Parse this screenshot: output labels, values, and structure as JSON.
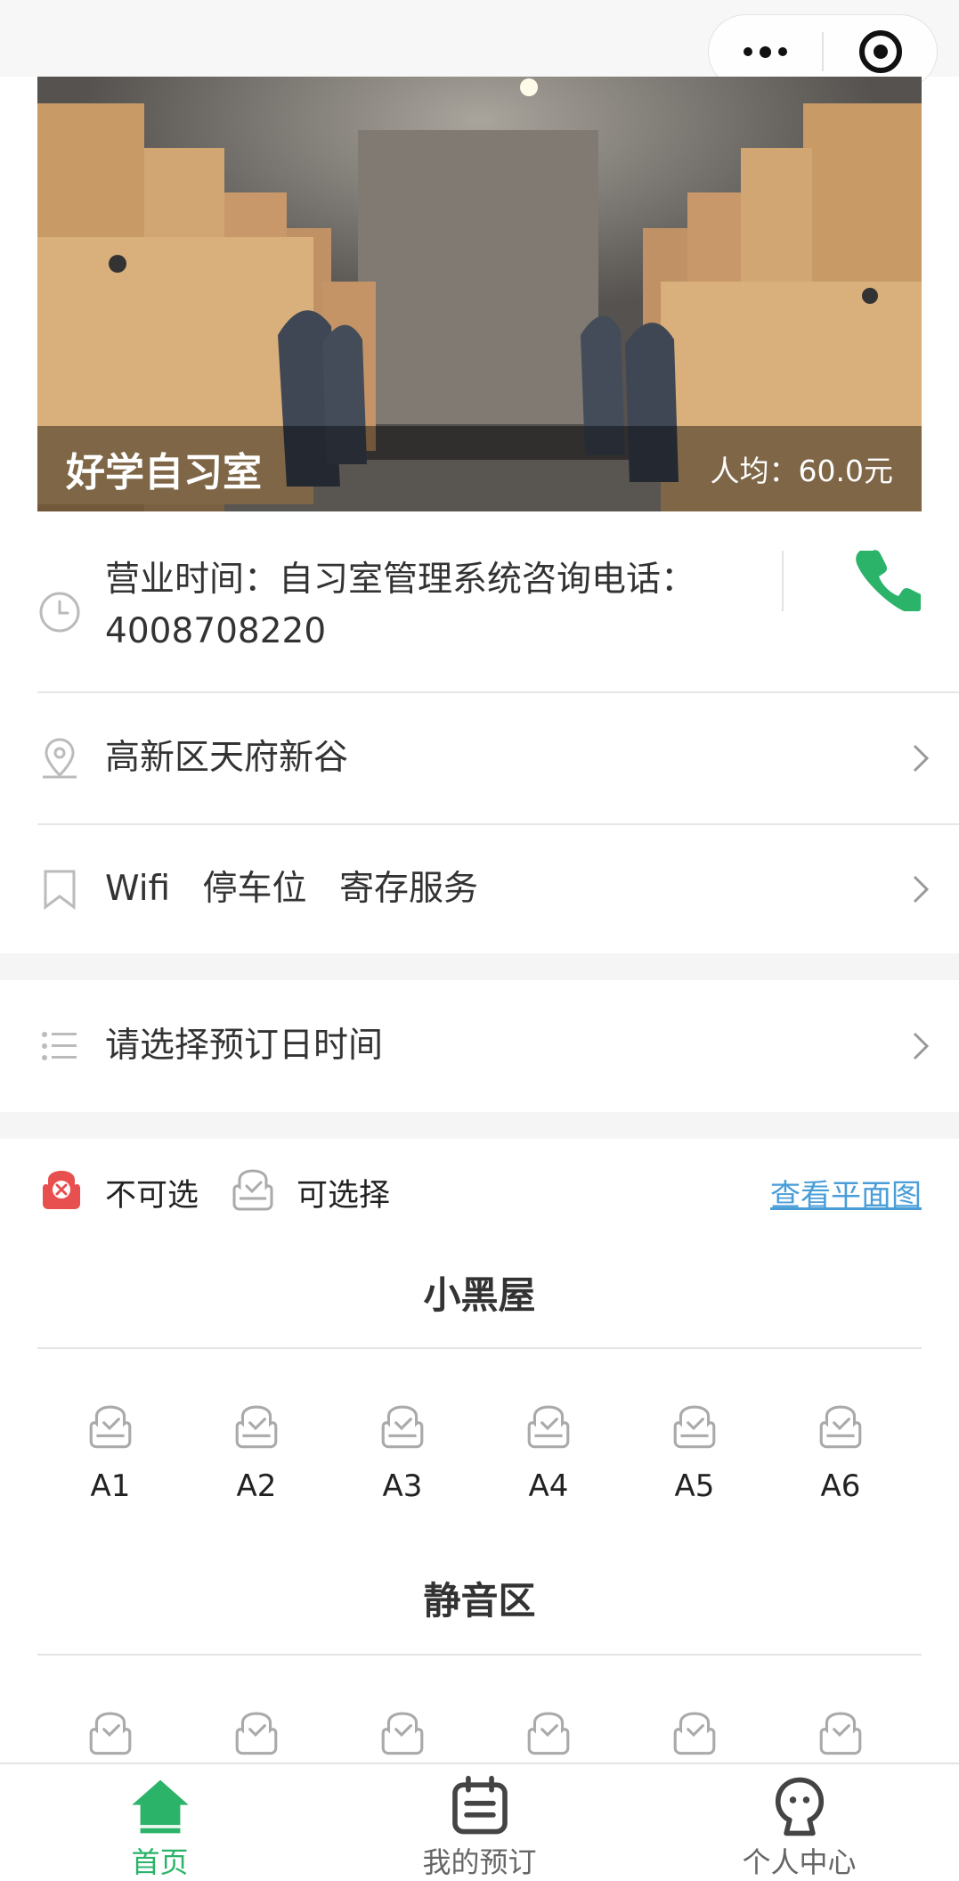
{
  "header": {
    "more_icon": "more-dots-icon",
    "close_icon": "target-icon"
  },
  "banner": {
    "title": "好学自习室",
    "price": "人均：60.0元"
  },
  "info": {
    "hours_text": "营业时间：自习室管理系统咨询电话：4008708220",
    "address": "高新区天府新谷",
    "facilities": [
      "Wifi",
      "停车位",
      "寄存服务"
    ],
    "date_select": "请选择预订日时间"
  },
  "legend": {
    "unavailable": "不可选",
    "available": "可选择",
    "view_plan": "查看平面图"
  },
  "sections": [
    {
      "name": "小黑屋",
      "seats": [
        "A1",
        "A2",
        "A3",
        "A4",
        "A5",
        "A6"
      ]
    },
    {
      "name": "静音区",
      "seats": [
        "",
        "",
        "",
        "",
        "",
        ""
      ]
    }
  ],
  "tabbar": {
    "tabs": [
      {
        "label": "首页",
        "icon": "home-icon",
        "active": true
      },
      {
        "label": "我的预订",
        "icon": "calendar-icon",
        "active": false
      },
      {
        "label": "个人中心",
        "icon": "user-icon",
        "active": false
      }
    ]
  },
  "colors": {
    "accent_green": "#2bb36a",
    "unavailable_red": "#e8504f",
    "link_blue": "#4a9ed8"
  }
}
